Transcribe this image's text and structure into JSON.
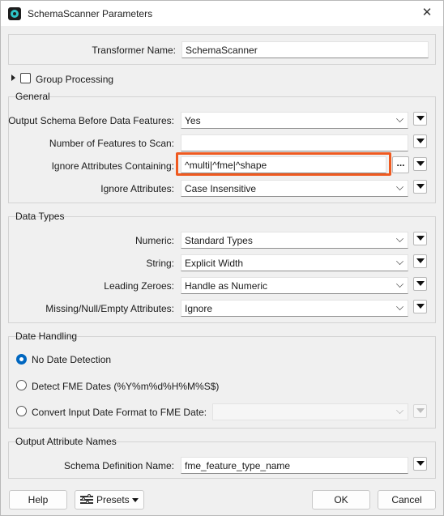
{
  "window": {
    "title": "SchemaScanner Parameters",
    "close_glyph": "✕"
  },
  "transformer": {
    "label": "Transformer Name:",
    "value": "SchemaScanner"
  },
  "group_processing": {
    "label": "Group Processing",
    "checked": false
  },
  "general": {
    "title": "General",
    "output_schema": {
      "label": "Output Schema Before Data Features:",
      "value": "Yes"
    },
    "num_features": {
      "label": "Number of Features to Scan:",
      "value": ""
    },
    "ignore_containing": {
      "label": "Ignore Attributes Containing:",
      "value": "^multi|^fme|^shape",
      "browse_label": "..."
    },
    "ignore_attributes": {
      "label": "Ignore Attributes:",
      "value": "Case Insensitive"
    }
  },
  "data_types": {
    "title": "Data Types",
    "numeric": {
      "label": "Numeric:",
      "value": "Standard Types"
    },
    "string": {
      "label": "String:",
      "value": "Explicit Width"
    },
    "leading_zeroes": {
      "label": "Leading Zeroes:",
      "value": "Handle as Numeric"
    },
    "missing": {
      "label": "Missing/Null/Empty Attributes:",
      "value": "Ignore"
    }
  },
  "date_handling": {
    "title": "Date Handling",
    "options": [
      {
        "label": "No Date Detection",
        "checked": true
      },
      {
        "label": "Detect FME Dates (%Y%m%d%H%M%S$)",
        "checked": false
      },
      {
        "label": "Convert Input Date Format to FME Date:",
        "checked": false
      }
    ],
    "convert_value": ""
  },
  "output_attr": {
    "title": "Output Attribute Names",
    "schema_def": {
      "label": "Schema Definition Name:",
      "value": "fme_feature_type_name"
    }
  },
  "footer": {
    "help": "Help",
    "presets": "Presets",
    "ok": "OK",
    "cancel": "Cancel"
  },
  "colors": {
    "highlight": "#ef5a20",
    "accent": "#0067c0"
  }
}
